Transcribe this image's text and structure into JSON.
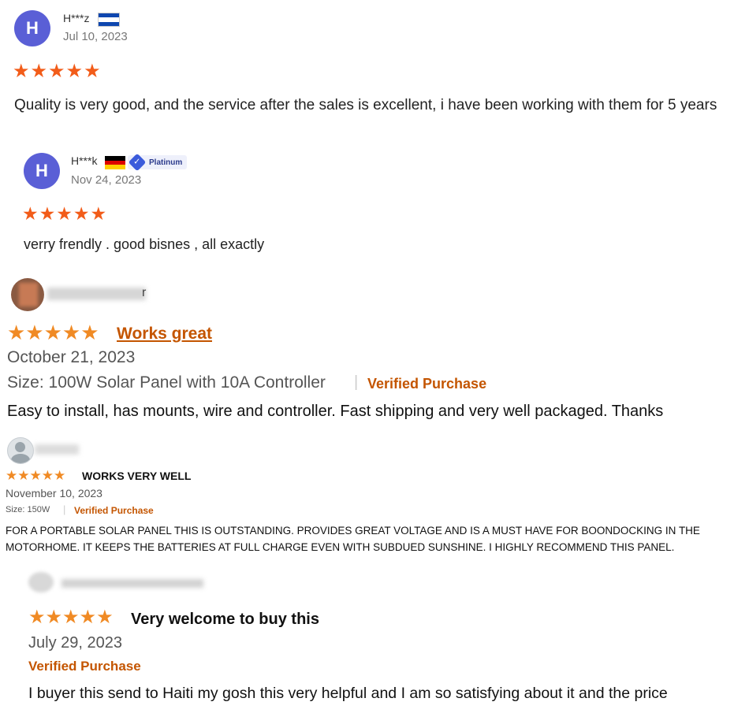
{
  "colors": {
    "avatar": "#5a5fd6",
    "star_alibaba": "#f25c19",
    "star_amazon": "#f08a24",
    "verified": "#c45500",
    "link": "#c45500"
  },
  "reviews": [
    {
      "avatar_letter": "H",
      "user": "H***z",
      "flag": "el-salvador-flag-icon",
      "date": "Jul 10, 2023",
      "rating": 5,
      "stars": "★★★★★",
      "text": "Quality is very good, and the service after the sales is excellent, i have been working with them for 5 years"
    },
    {
      "avatar_letter": "H",
      "user": "H***k",
      "flag": "germany-flag-icon",
      "badge": "Platinum",
      "date": "Nov 24, 2023",
      "rating": 5,
      "stars": "★★★★★",
      "text": "verry frendly . good bisnes , all exactly"
    },
    {
      "rating": 5,
      "stars": "★★★★★",
      "title": "Works great",
      "date": "October 21, 2023",
      "size": "Size: 100W Solar Panel with 10A Controller",
      "separator": "|",
      "verified": "Verified Purchase",
      "text": "Easy to install, has mounts, wire and controller. Fast shipping and very well packaged. Thanks"
    },
    {
      "rating": 5,
      "stars": "★★★★★",
      "title": "WORKS VERY WELL",
      "date": "November 10, 2023",
      "size": "Size: 150W",
      "separator": "|",
      "verified": "Verified Purchase",
      "text_line1": "FOR A PORTABLE SOLAR PANEL THIS IS OUTSTANDING. PROVIDES GREAT VOLTAGE AND IS A MUST HAVE FOR BOONDOCKING IN THE",
      "text_line2": "MOTORHOME. IT KEEPS THE BATTERIES AT FULL CHARGE EVEN WITH SUBDUED SUNSHINE. I HIGHLY RECOMMEND THIS PANEL."
    },
    {
      "rating": 5,
      "stars": "★★★★★",
      "title": "Very welcome to buy this",
      "date": "July 29, 2023",
      "verified": "Verified Purchase",
      "text": "I buyer this send to Haiti my gosh this very helpful and I am so satisfying about it and the price"
    }
  ]
}
